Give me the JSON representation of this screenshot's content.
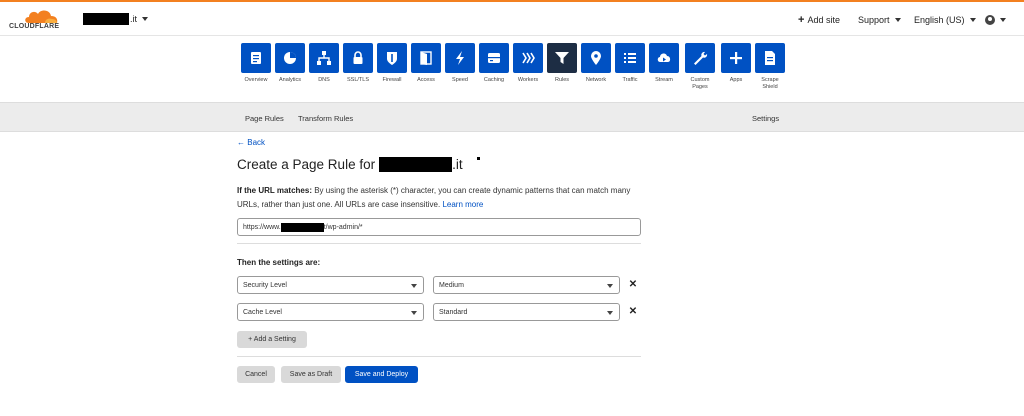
{
  "brand": {
    "logo_text": "CLOUDFLARE",
    "accent": "#f38020",
    "primary": "#0051c3",
    "active_tile": "#1d2d44"
  },
  "topbar": {
    "domain_suffix": ".it",
    "add_site": "Add site",
    "support": "Support",
    "language": "English (US)"
  },
  "apps": [
    {
      "label": "Overview",
      "icon": "overview-icon"
    },
    {
      "label": "Analytics",
      "icon": "analytics-icon"
    },
    {
      "label": "DNS",
      "icon": "dns-icon"
    },
    {
      "label": "SSL/TLS",
      "icon": "lock-icon"
    },
    {
      "label": "Firewall",
      "icon": "firewall-icon"
    },
    {
      "label": "Access",
      "icon": "access-icon"
    },
    {
      "label": "Speed",
      "icon": "speed-icon"
    },
    {
      "label": "Caching",
      "icon": "caching-icon"
    },
    {
      "label": "Workers",
      "icon": "workers-icon"
    },
    {
      "label": "Rules",
      "icon": "rules-icon"
    },
    {
      "label": "Network",
      "icon": "network-icon"
    },
    {
      "label": "Traffic",
      "icon": "traffic-icon"
    },
    {
      "label": "Stream",
      "icon": "stream-icon"
    },
    {
      "label": "Custom\nPages",
      "icon": "custom-pages-icon"
    },
    {
      "label": "Apps",
      "icon": "apps-icon"
    },
    {
      "label": "Scrape\nShield",
      "icon": "scrape-shield-icon"
    }
  ],
  "active_app": "Rules",
  "subnav": {
    "page_rules": "Page Rules",
    "transform_rules": "Transform Rules",
    "settings": "Settings"
  },
  "form": {
    "back": "Back",
    "title_prefix": "Create a Page Rule for",
    "title_suffix": ".it",
    "if_label": "If the URL matches:",
    "description": " By using the asterisk (*) character, you can create dynamic patterns that can match many URLs, rather than just one. All URLs are case insensitive. ",
    "learn_more": "Learn more",
    "url_prefix": "https://www.",
    "url_suffix": "t/wp-admin/*",
    "then_label": "Then the settings are:",
    "settings": [
      {
        "name": "Security Level",
        "value": "Medium"
      },
      {
        "name": "Cache Level",
        "value": "Standard"
      }
    ],
    "add_setting": "+ Add a Setting",
    "cancel": "Cancel",
    "save_draft": "Save as Draft",
    "save_deploy": "Save and Deploy"
  }
}
